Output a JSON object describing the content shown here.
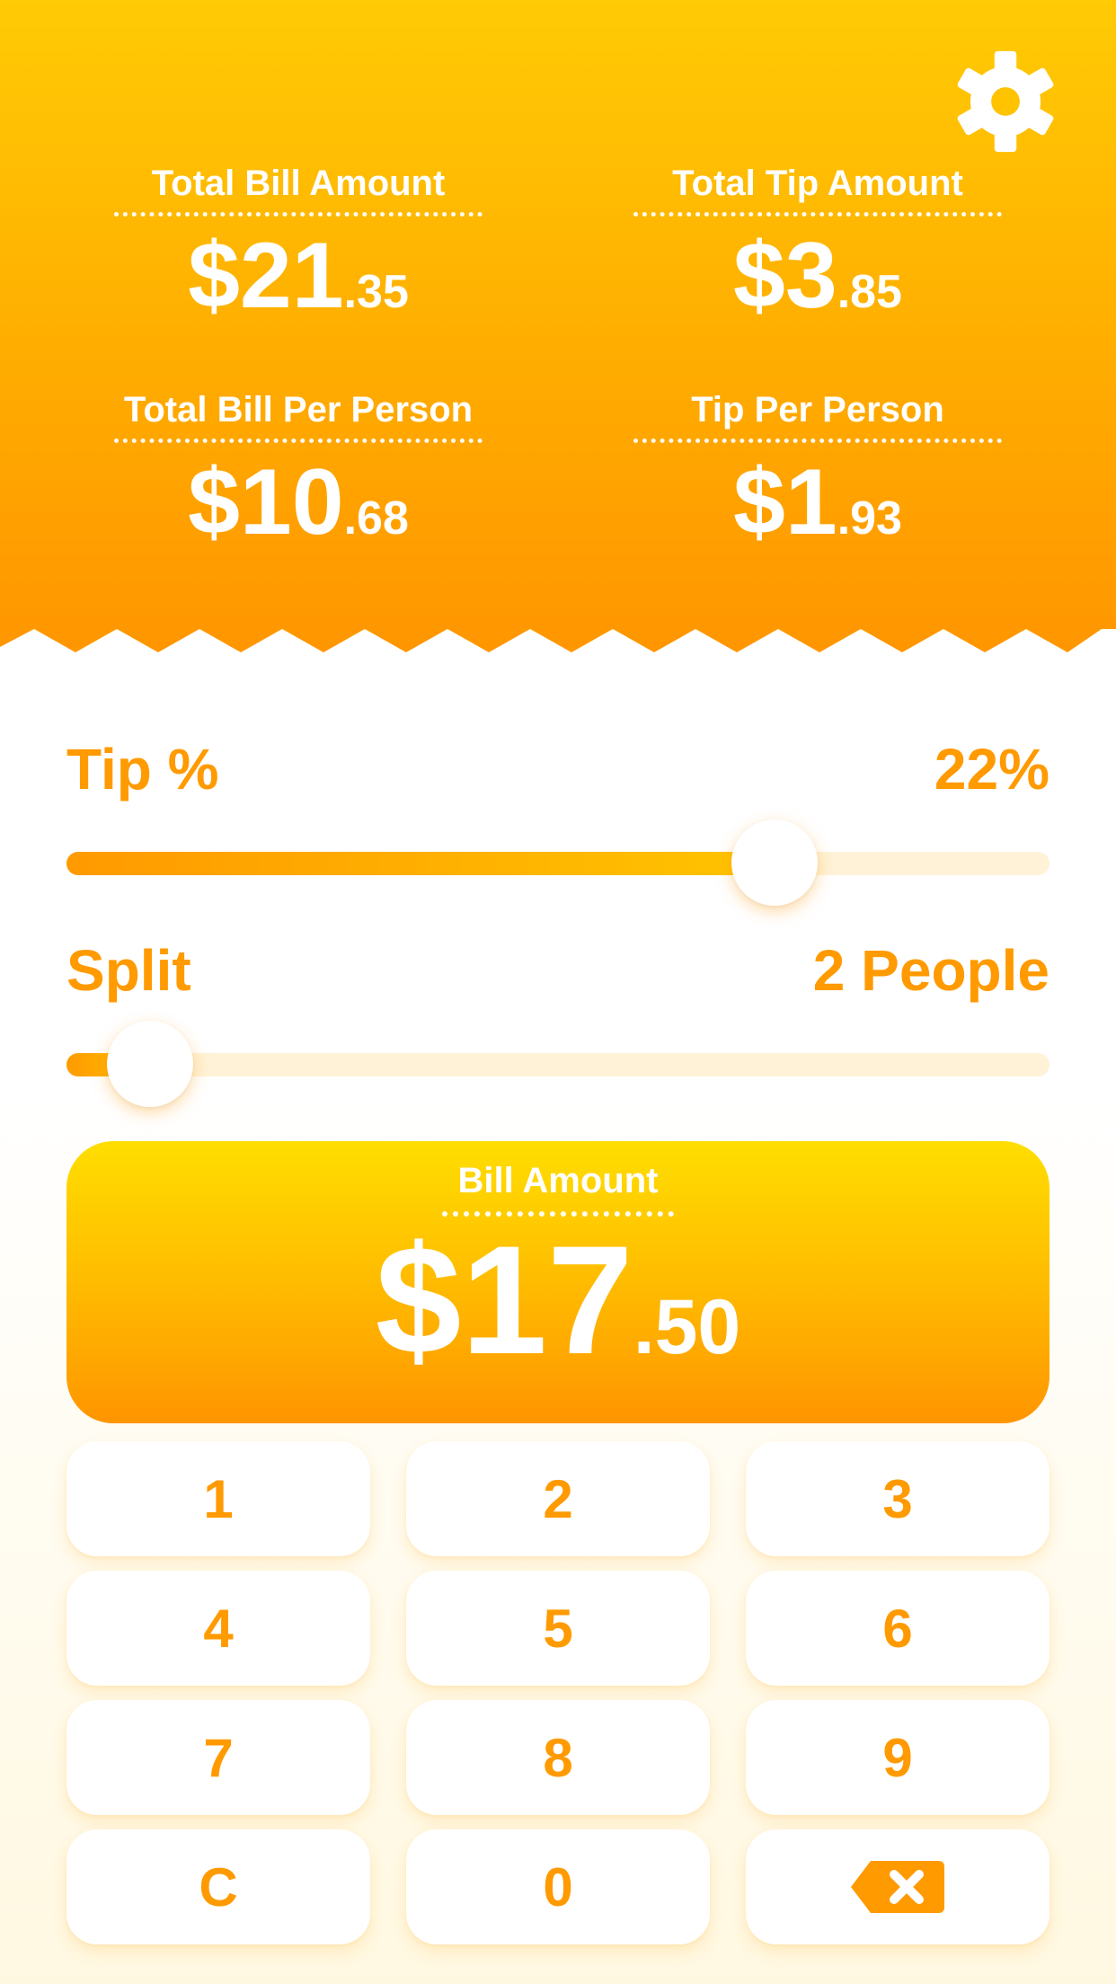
{
  "summary": {
    "total_bill": {
      "label": "Total Bill Amount",
      "dollars": "$21",
      "cents": ".35"
    },
    "total_tip": {
      "label": "Total Tip Amount",
      "dollars": "$3",
      "cents": ".85"
    },
    "bill_per_person": {
      "label": "Total Bill Per Person",
      "dollars": "$10",
      "cents": ".68"
    },
    "tip_per_person": {
      "label": "Tip Per Person",
      "dollars": "$1",
      "cents": ".93"
    }
  },
  "tip": {
    "label": "Tip %",
    "value": "22%",
    "slider_fraction": 0.72
  },
  "split": {
    "label": "Split",
    "value": "2 People",
    "slider_fraction": 0.085
  },
  "bill": {
    "label": "Bill Amount",
    "dollars": "$17",
    "cents": ".50"
  },
  "keypad": {
    "keys": [
      "1",
      "2",
      "3",
      "4",
      "5",
      "6",
      "7",
      "8",
      "9",
      "C",
      "0"
    ],
    "backspace_icon": "backspace-icon"
  },
  "icons": {
    "settings": "gear-icon"
  },
  "colors": {
    "accent": "#ff9a00",
    "header_top": "#ffcb05",
    "header_bottom": "#ff9500",
    "track": "#fff2d6"
  }
}
